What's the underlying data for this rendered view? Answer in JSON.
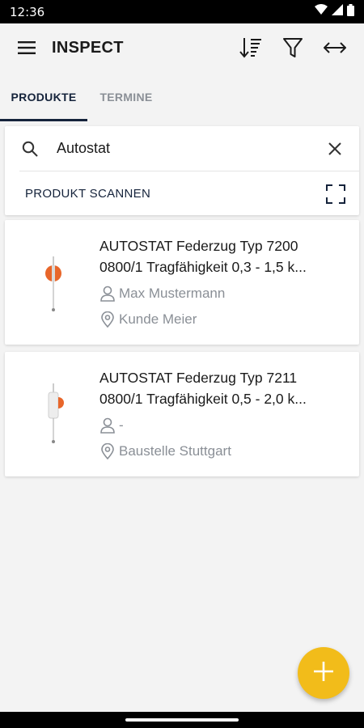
{
  "status_bar": {
    "time": "12:36"
  },
  "app_bar": {
    "title": "INSPECT",
    "icons": [
      "menu-icon",
      "sort-icon",
      "filter-icon",
      "expand-horizontal-icon"
    ]
  },
  "tabs": [
    {
      "label": "PRODUKTE",
      "active": true
    },
    {
      "label": "TERMINE",
      "active": false
    }
  ],
  "search": {
    "value": "Autostat",
    "scan_label": "PRODUKT SCANNEN"
  },
  "products": [
    {
      "name_line1": "AUTOSTAT Federzug Typ 7200",
      "name_line2": "0800/1 Tragfähigkeit 0,3 - 1,5 k...",
      "person": "Max Mustermann",
      "location": "Kunde Meier"
    },
    {
      "name_line1": "AUTOSTAT Federzug Typ 7211",
      "name_line2": "0800/1 Tragfähigkeit 0,5 - 2,0 k...",
      "person": "-",
      "location": "Baustelle Stuttgart"
    }
  ],
  "colors": {
    "accent": "#15233b",
    "fab": "#f2bc1a",
    "product_orange": "#e8662a"
  }
}
